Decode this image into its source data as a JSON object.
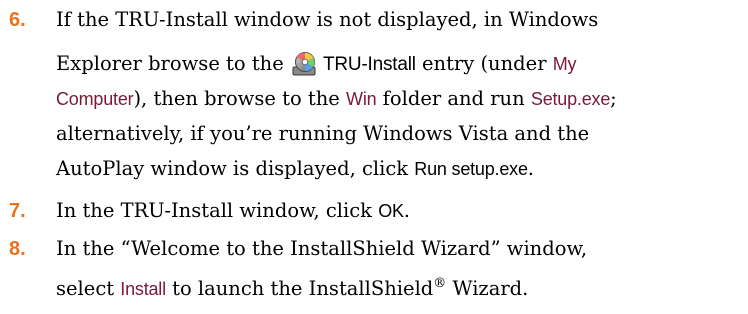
{
  "steps": [
    {
      "number": "6.",
      "l1": "If the TRU-Install window is not displayed, in Windows",
      "l2a": "Explorer browse to the",
      "l2_entry": "TRU-Install",
      "l2b": " entry (under ",
      "l2_ui1": "My",
      "l3_ui1": "Computer",
      "l3a": "), then browse to the ",
      "l3_ui2": "Win",
      "l3b": " folder and run ",
      "l3_ui3": "Setup.exe",
      "l3c": ";",
      "l4": "alternatively, if you’re running Windows Vista and the",
      "l5a": "AutoPlay window is displayed, click ",
      "l5_ui": "Run setup.exe",
      "l5b": "."
    },
    {
      "number": "7.",
      "a": "In the TRU-Install window, click ",
      "ui": "OK",
      "b": "."
    },
    {
      "number": "8.",
      "l1": "In the “Welcome to the InstallShield Wizard” window,",
      "l2a": "select ",
      "l2_ui": "Install",
      "l2b": " to launch the InstallShield",
      "l2_reg": "®",
      "l2c": " Wizard."
    }
  ],
  "colors": {
    "step_number": "#e8731c",
    "ui_accent": "#7a1a36"
  },
  "icons": {
    "entry_icon": "cd-drive-icon"
  }
}
